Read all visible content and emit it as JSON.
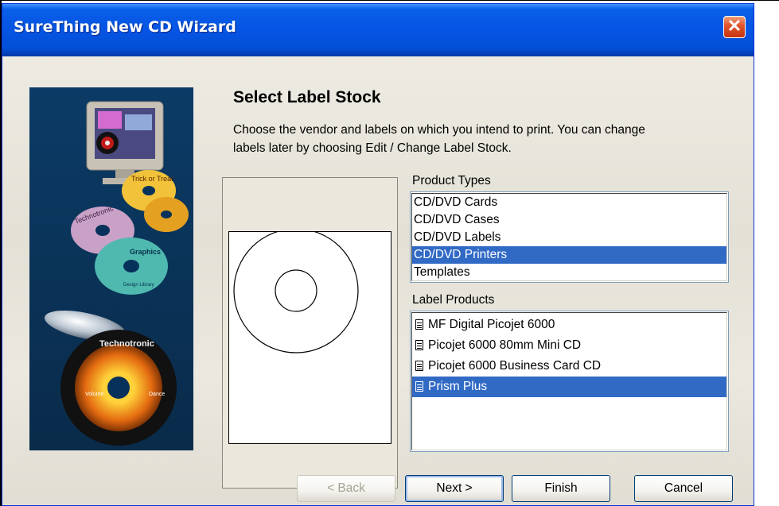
{
  "window": {
    "title": "SureThing New CD Wizard",
    "close_glyph": "✕"
  },
  "page": {
    "heading": "Select Label Stock",
    "description": "Choose the vendor and labels on which you intend to print. You can change labels later by choosing Edit / Change Label Stock."
  },
  "product_types": {
    "label": "Product Types",
    "items": [
      "CD/DVD Cards",
      "CD/DVD Cases",
      "CD/DVD Labels",
      "CD/DVD Printers",
      "Templates"
    ],
    "selected": "CD/DVD Printers"
  },
  "label_products": {
    "label": "Label Products",
    "items": [
      "MF Digital Picojet 6000",
      "Picojet 6000 80mm Mini CD",
      "Picojet 6000 Business Card CD",
      "Prism Plus"
    ],
    "selected": "Prism Plus"
  },
  "buttons": {
    "back": "< Back",
    "next": "Next >",
    "finish": "Finish",
    "cancel": "Cancel"
  },
  "side_image_text": {
    "technotronic_1": "Technotronic",
    "graphics": "Graphics",
    "design_library": "Design Library",
    "technotronic_2": "Technotronic",
    "volume": "Volume",
    "dance": "Dance",
    "trick_or_treat": "Trick or Treat"
  },
  "colors": {
    "title_bar": "#0554e3",
    "selection": "#316ac5",
    "close_button": "#e2582f"
  }
}
